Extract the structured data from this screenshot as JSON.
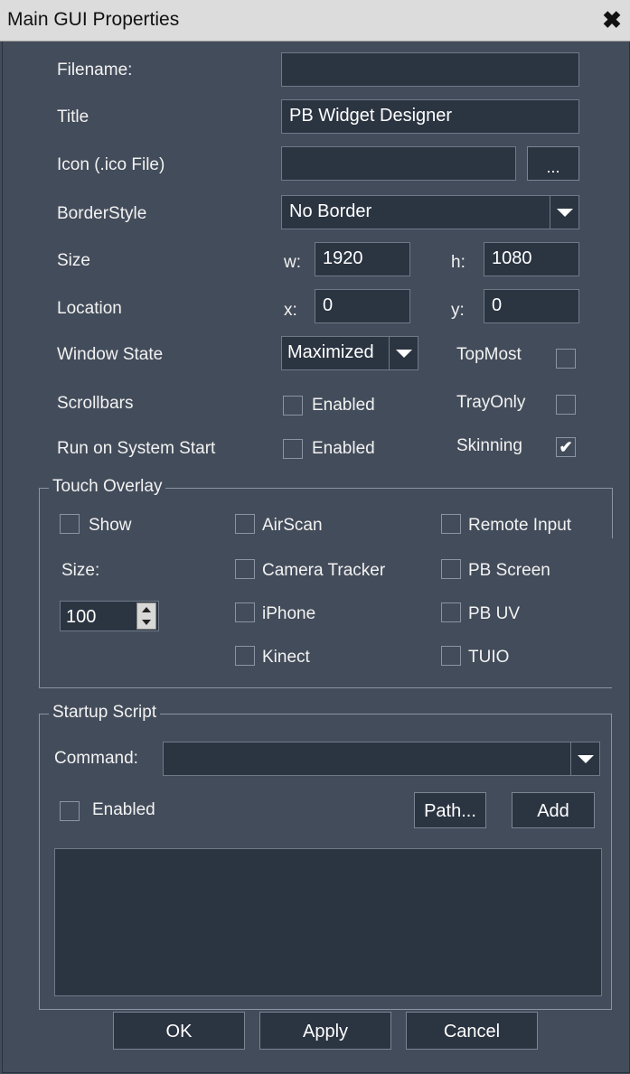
{
  "window": {
    "title": "Main GUI Properties",
    "close_glyph": "✖"
  },
  "labels": {
    "filename": "Filename:",
    "title": "Title",
    "icon": "Icon (.ico File)",
    "border_style": "BorderStyle",
    "size": "Size",
    "location": "Location",
    "window_state": "Window State",
    "scrollbars": "Scrollbars",
    "run_on_start": "Run on System Start",
    "w": "w:",
    "h": "h:",
    "x": "x:",
    "y": "y:",
    "topmost": "TopMost",
    "tray_only": "TrayOnly",
    "skinning": "Skinning",
    "enabled": "Enabled"
  },
  "fields": {
    "filename": "",
    "title": "PB Widget Designer",
    "icon": "",
    "icon_browse": "...",
    "border_style": "No Border",
    "width": "1920",
    "height": "1080",
    "loc_x": "0",
    "loc_y": "0",
    "window_state": "Maximized"
  },
  "checks": {
    "topmost": false,
    "tray_only": false,
    "skinning": true,
    "scrollbars": false,
    "run_on_start": false,
    "check_glyph": "✔"
  },
  "touch_overlay": {
    "title": "Touch Overlay",
    "show": "Show",
    "size_label": "Size:",
    "size_value": "100",
    "airscan": "AirScan",
    "camera_tracker": "Camera Tracker",
    "iphone": "iPhone",
    "kinect": "Kinect",
    "remote_input": "Remote Input",
    "pb_screen": "PB Screen",
    "pb_uv": "PB UV",
    "tuio": "TUIO"
  },
  "startup_script": {
    "title": "Startup Script",
    "command_label": "Command:",
    "command_value": "",
    "enabled": "Enabled",
    "path_button": "Path...",
    "add_button": "Add"
  },
  "footer": {
    "ok": "OK",
    "apply": "Apply",
    "cancel": "Cancel"
  }
}
